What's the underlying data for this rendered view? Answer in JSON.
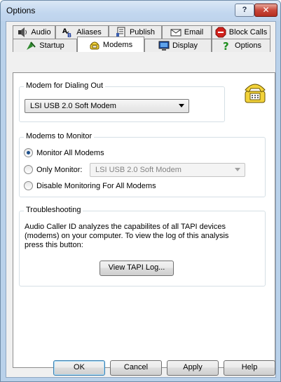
{
  "window": {
    "title": "Options",
    "help_glyph": "?",
    "close_glyph": "✕"
  },
  "tabs_row1": [
    {
      "label": "Audio",
      "icon": "speaker-icon"
    },
    {
      "label": "Aliases",
      "icon": "aliases-icon"
    },
    {
      "label": "Publish",
      "icon": "publish-icon"
    },
    {
      "label": "Email",
      "icon": "email-icon"
    },
    {
      "label": "Block Calls",
      "icon": "stop-sign-icon"
    }
  ],
  "tabs_row2": [
    {
      "label": "Startup",
      "icon": "startup-icon"
    },
    {
      "label": "Modems",
      "icon": "modem-icon",
      "active": true
    },
    {
      "label": "Display",
      "icon": "monitor-icon"
    },
    {
      "label": "Options",
      "icon": "question-icon"
    }
  ],
  "modem_dialing": {
    "title": "Modem for Dialing Out",
    "selected": "LSI USB 2.0 Soft Modem"
  },
  "modems_to_monitor": {
    "title": "Modems to Monitor",
    "option_all": "Monitor All Modems",
    "option_only": "Only Monitor:",
    "only_selected": "LSI USB 2.0 Soft Modem",
    "option_disable": "Disable Monitoring For All Modems",
    "selected_option": "all"
  },
  "troubleshooting": {
    "title": "Troubleshooting",
    "line1": "Audio Caller ID analyzes the capabilites of all TAPI devices",
    "line2": "(modems) on your computer.  To view the log of this analysis",
    "line3": "press this button:",
    "button": "View TAPI Log..."
  },
  "footer": {
    "ok": "OK",
    "cancel": "Cancel",
    "apply": "Apply",
    "help": "Help"
  },
  "colors": {
    "frame": "#b9d1ea",
    "close": "#c9473a",
    "accent": "#1d4f8c"
  }
}
